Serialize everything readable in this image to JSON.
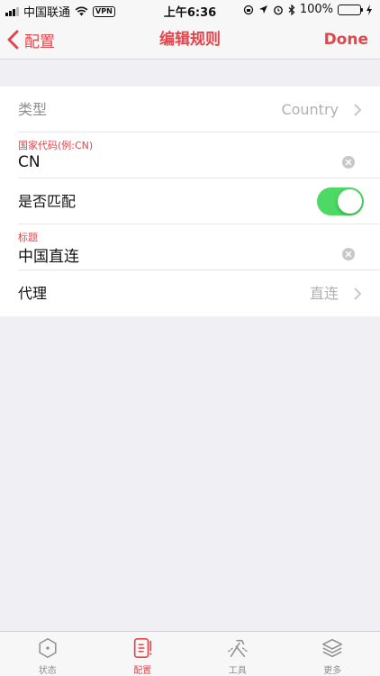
{
  "status_bar": {
    "carrier": "中国联通",
    "vpn": "VPN",
    "time": "上午6:36",
    "battery": "100%"
  },
  "nav": {
    "back_label": "配置",
    "title": "编辑规则",
    "done_label": "Done"
  },
  "form": {
    "type_label": "类型",
    "type_value": "Country",
    "country_code_label": "国家代码(例:CN)",
    "country_code_value": "CN",
    "match_label": "是否匹配",
    "match_enabled": true,
    "title_label": "标题",
    "title_value": "中国直连",
    "proxy_label": "代理",
    "proxy_value": "直连"
  },
  "tabs": [
    {
      "label": "状态",
      "icon": "hexagon-dot-icon",
      "active": false
    },
    {
      "label": "配置",
      "icon": "document-icon",
      "active": true
    },
    {
      "label": "工具",
      "icon": "tools-icon",
      "active": false
    },
    {
      "label": "更多",
      "icon": "layers-icon",
      "active": false
    }
  ],
  "colors": {
    "accent": "#e0474c",
    "toggle_on": "#4cd964",
    "background": "#efeff4"
  }
}
